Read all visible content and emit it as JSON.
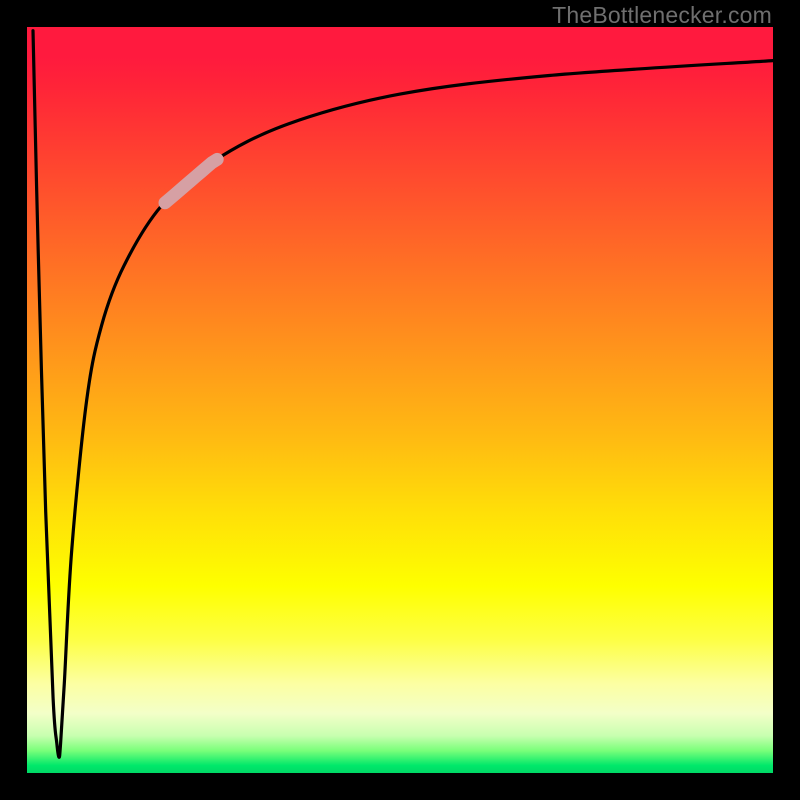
{
  "watermark": "TheBottlenecker.com",
  "chart_data": {
    "type": "line",
    "title": "",
    "xlabel": "",
    "ylabel": "",
    "xlim": [
      0,
      100
    ],
    "ylim": [
      0,
      100
    ],
    "series": [
      {
        "name": "bottleneck-curve",
        "x": [
          0.8,
          1.5,
          2.5,
          3.5,
          4.0,
          4.3,
          4.5,
          5.0,
          6.0,
          8.0,
          10.0,
          13.0,
          18.0,
          25.0,
          35.0,
          50.0,
          70.0,
          100.0
        ],
        "y": [
          99.5,
          70.0,
          35.0,
          10.0,
          4.0,
          2.1,
          4.0,
          12.0,
          30.0,
          50.0,
          60.0,
          68.0,
          76.0,
          82.0,
          87.0,
          91.0,
          93.5,
          95.5
        ]
      }
    ],
    "highlight": {
      "x_range": [
        18.5,
        25.5
      ]
    },
    "gradient_stops": [
      {
        "pos": 0.0,
        "color": "#ff1a3e"
      },
      {
        "pos": 0.75,
        "color": "#feff00"
      },
      {
        "pos": 1.0,
        "color": "#00d966"
      }
    ]
  }
}
